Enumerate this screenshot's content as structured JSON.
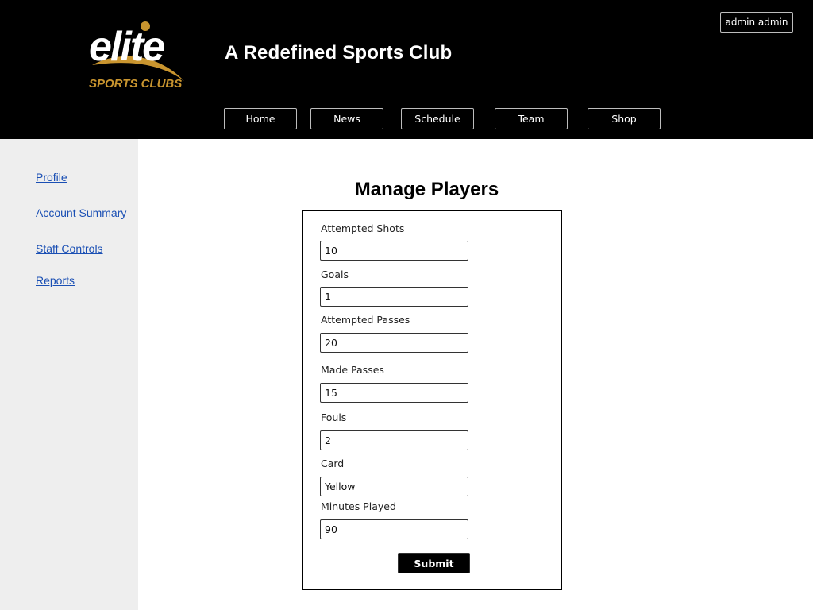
{
  "header": {
    "logo": {
      "wordmark": "elite",
      "tagline": "SPORTS CLUBS",
      "colors": {
        "wordmark": "#ffffff",
        "tagline": "#c9952f",
        "swoosh": "#c9952f"
      }
    },
    "site_title": "A Redefined Sports Club",
    "user_label": "admin admin",
    "nav": [
      {
        "label": "Home"
      },
      {
        "label": "News"
      },
      {
        "label": "Schedule"
      },
      {
        "label": "Team"
      },
      {
        "label": "Shop"
      }
    ]
  },
  "sidebar": {
    "links": [
      {
        "label": "Profile"
      },
      {
        "label": "Account Summary"
      },
      {
        "label": "Staff Controls"
      },
      {
        "label": "Reports"
      }
    ]
  },
  "main": {
    "title": "Manage Players",
    "fields": [
      {
        "label": "Attempted Shots",
        "value": "10"
      },
      {
        "label": "Goals",
        "value": "1"
      },
      {
        "label": "Attempted Passes",
        "value": "20"
      },
      {
        "label": "Made Passes",
        "value": "15"
      },
      {
        "label": "Fouls",
        "value": "2"
      },
      {
        "label": "Card",
        "value": "Yellow"
      },
      {
        "label": "Minutes Played",
        "value": "90"
      }
    ],
    "submit_label": "Submit"
  },
  "colors": {
    "header_bg": "#000000",
    "sidebar_bg": "#eeeeee",
    "link": "#1a4fb4",
    "accent_gold": "#c9952f"
  }
}
